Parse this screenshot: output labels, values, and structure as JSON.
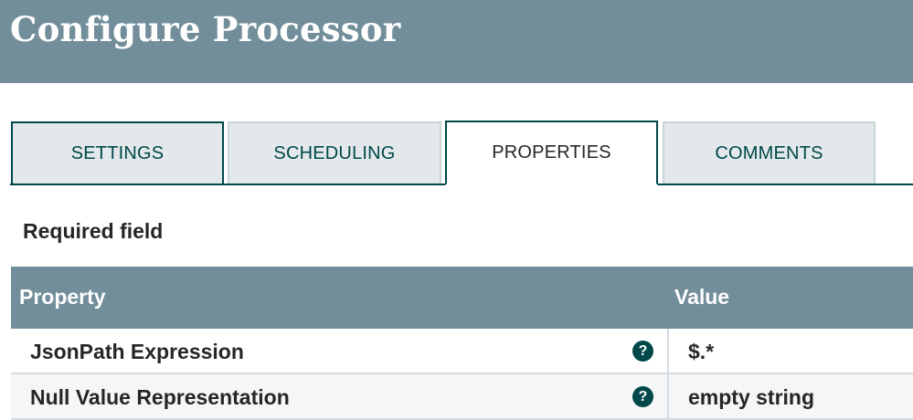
{
  "dialog": {
    "title": "Configure Processor"
  },
  "tabs": [
    {
      "label": "SETTINGS",
      "active": false
    },
    {
      "label": "SCHEDULING",
      "active": false
    },
    {
      "label": "PROPERTIES",
      "active": true
    },
    {
      "label": "COMMENTS",
      "active": false
    }
  ],
  "required_label": "Required field",
  "grid": {
    "headers": {
      "property": "Property",
      "value": "Value"
    },
    "rows": [
      {
        "property": "JsonPath Expression",
        "value": "$.*",
        "help_icon": "question-circle-icon"
      },
      {
        "property": "Null Value Representation",
        "value": "empty string",
        "help_icon": "question-circle-icon"
      }
    ]
  },
  "colors": {
    "header_bg": "#728e9b",
    "accent": "#004849",
    "tab_inactive_bg": "#e3e8eb"
  }
}
